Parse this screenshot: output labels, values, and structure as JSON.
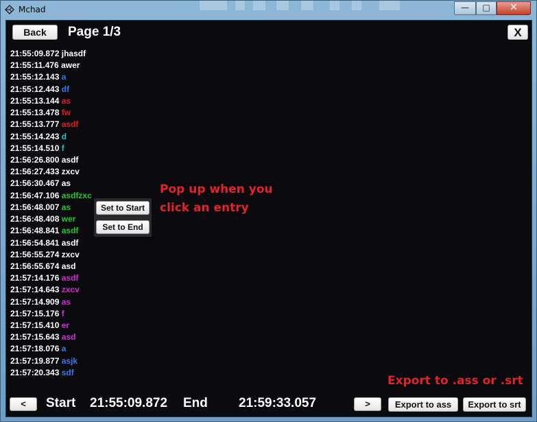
{
  "window": {
    "title": "Mchad",
    "controls": {
      "minimize": "—",
      "maximize": "□",
      "close": "✕"
    }
  },
  "header": {
    "back_label": "Back",
    "page_title": "Page 1/3",
    "close_label": "X"
  },
  "entries": [
    {
      "time": "21:55:09.872",
      "text": "jhasdf",
      "color": "#ffffff"
    },
    {
      "time": "21:55:11.476",
      "text": "awer",
      "color": "#ffffff"
    },
    {
      "time": "21:55:12.143",
      "text": "a",
      "color": "#3a78e6"
    },
    {
      "time": "21:55:12.443",
      "text": "df",
      "color": "#3a78e6"
    },
    {
      "time": "21:55:13.144",
      "text": "as",
      "color": "#e0211f"
    },
    {
      "time": "21:55:13.478",
      "text": "fw",
      "color": "#e0211f"
    },
    {
      "time": "21:55:13.777",
      "text": "asdf",
      "color": "#e0211f"
    },
    {
      "time": "21:55:14.243",
      "text": "d",
      "color": "#19c4c4"
    },
    {
      "time": "21:55:14.510",
      "text": "f",
      "color": "#19c4c4"
    },
    {
      "time": "21:56:26.800",
      "text": "asdf",
      "color": "#ffffff"
    },
    {
      "time": "21:56:27.433",
      "text": "zxcv",
      "color": "#ffffff"
    },
    {
      "time": "21:56:30.467",
      "text": "as",
      "color": "#ffffff"
    },
    {
      "time": "21:56:47.106",
      "text": "asdfzxc",
      "color": "#22c92c"
    },
    {
      "time": "21:56:48.007",
      "text": "as",
      "color": "#22c92c"
    },
    {
      "time": "21:56:48.408",
      "text": "wer",
      "color": "#22c92c"
    },
    {
      "time": "21:56:48.841",
      "text": "asdf",
      "color": "#22c92c"
    },
    {
      "time": "21:56:54.841",
      "text": "asdf",
      "color": "#ffffff"
    },
    {
      "time": "21:56:55.274",
      "text": "zxcv",
      "color": "#ffffff"
    },
    {
      "time": "21:56:55.674",
      "text": "asd",
      "color": "#ffffff"
    },
    {
      "time": "21:57:14.176",
      "text": "asdf",
      "color": "#d12ed1"
    },
    {
      "time": "21:57:14.643",
      "text": "zxcv",
      "color": "#d12ed1"
    },
    {
      "time": "21:57:14.909",
      "text": "as",
      "color": "#d12ed1"
    },
    {
      "time": "21:57:15.176",
      "text": "f",
      "color": "#d12ed1"
    },
    {
      "time": "21:57:15.410",
      "text": "er",
      "color": "#d12ed1"
    },
    {
      "time": "21:57:15.643",
      "text": "asd",
      "color": "#d12ed1"
    },
    {
      "time": "21:57:18.076",
      "text": "a",
      "color": "#3a78e6"
    },
    {
      "time": "21:57:19.877",
      "text": "asjk",
      "color": "#3a78e6"
    },
    {
      "time": "21:57:20.343",
      "text": "sdf",
      "color": "#3a78e6"
    }
  ],
  "popup": {
    "set_start_label": "Set to Start",
    "set_end_label": "Set to End"
  },
  "annotations": {
    "popup_note": [
      "Pop up when you",
      "click an entry"
    ],
    "export_note": "Export to .ass or .srt",
    "color": "#e0242a"
  },
  "footer": {
    "prev_label": "<",
    "start_label": "Start",
    "start_value": "21:55:09.872",
    "end_label": "End",
    "end_value": "21:59:33.057",
    "next_label": ">",
    "export_ass_label": "Export to ass",
    "export_srt_label": "Export to srt"
  }
}
